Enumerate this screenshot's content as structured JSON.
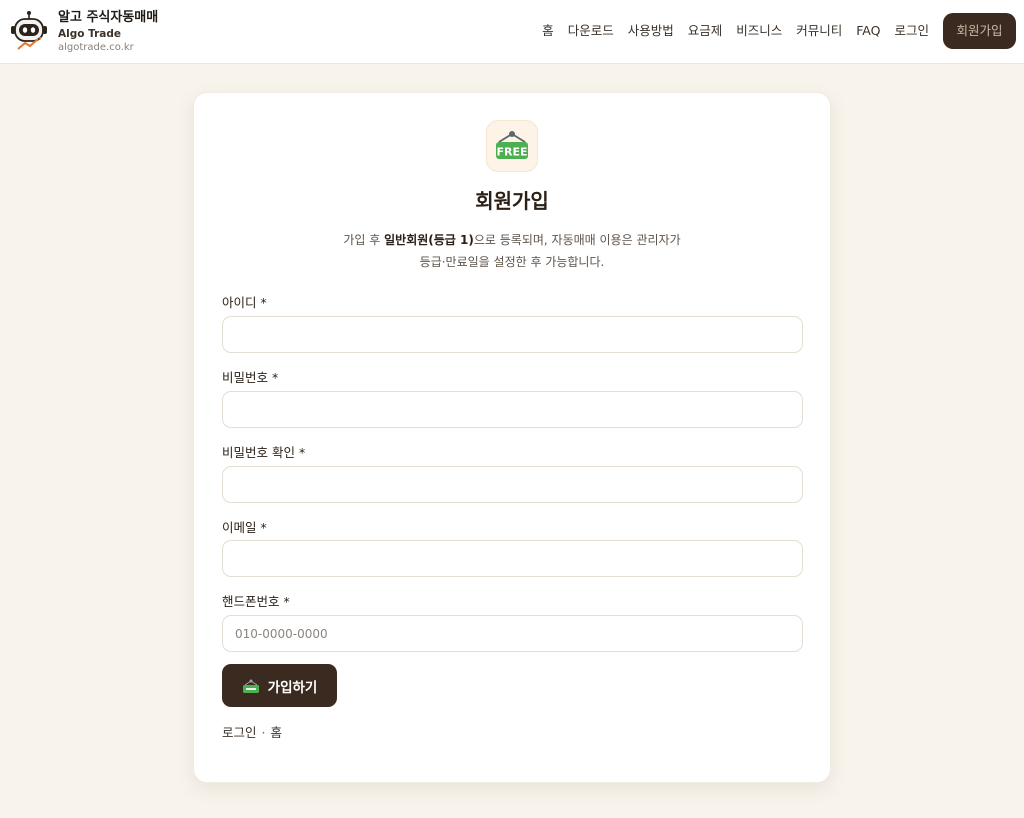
{
  "brand": {
    "title": "알고 주식자동매매",
    "subtitle": "Algo Trade",
    "domain": "algotrade.co.kr",
    "logo_icon": "robot-icon"
  },
  "nav": {
    "items": [
      "홈",
      "다운로드",
      "사용방법",
      "요금제",
      "비즈니스",
      "커뮤니티",
      "FAQ",
      "로그인"
    ],
    "signup_label": "회원가입"
  },
  "card": {
    "badge_icon": "free-sign-icon",
    "badge_text": "FREE",
    "title": "회원가입",
    "desc_pre": "가입 후 ",
    "desc_bold": "일반회원(등급 1)",
    "desc_post": "으로 등록되며, 자동매매 이용은 관리자가",
    "desc_line2": "등급·만료일을 설정한 후 가능합니다."
  },
  "form": {
    "fields": [
      {
        "label": "아이디 *",
        "value": "",
        "placeholder": ""
      },
      {
        "label": "비밀번호 *",
        "value": "",
        "placeholder": ""
      },
      {
        "label": "비밀번호 확인 *",
        "value": "",
        "placeholder": ""
      },
      {
        "label": "이메일 *",
        "value": "",
        "placeholder": ""
      },
      {
        "label": "핸드폰번호 *",
        "value": "",
        "placeholder": "010-0000-0000"
      }
    ],
    "submit_label": "가입하기",
    "submit_icon": "free-sign-icon"
  },
  "footer": {
    "login_label": "로그인",
    "separator": "·",
    "home_label": "홈"
  },
  "colors": {
    "accent": "#3b2a1f",
    "background": "#f8f4ec",
    "free_green": "#4caf50"
  }
}
